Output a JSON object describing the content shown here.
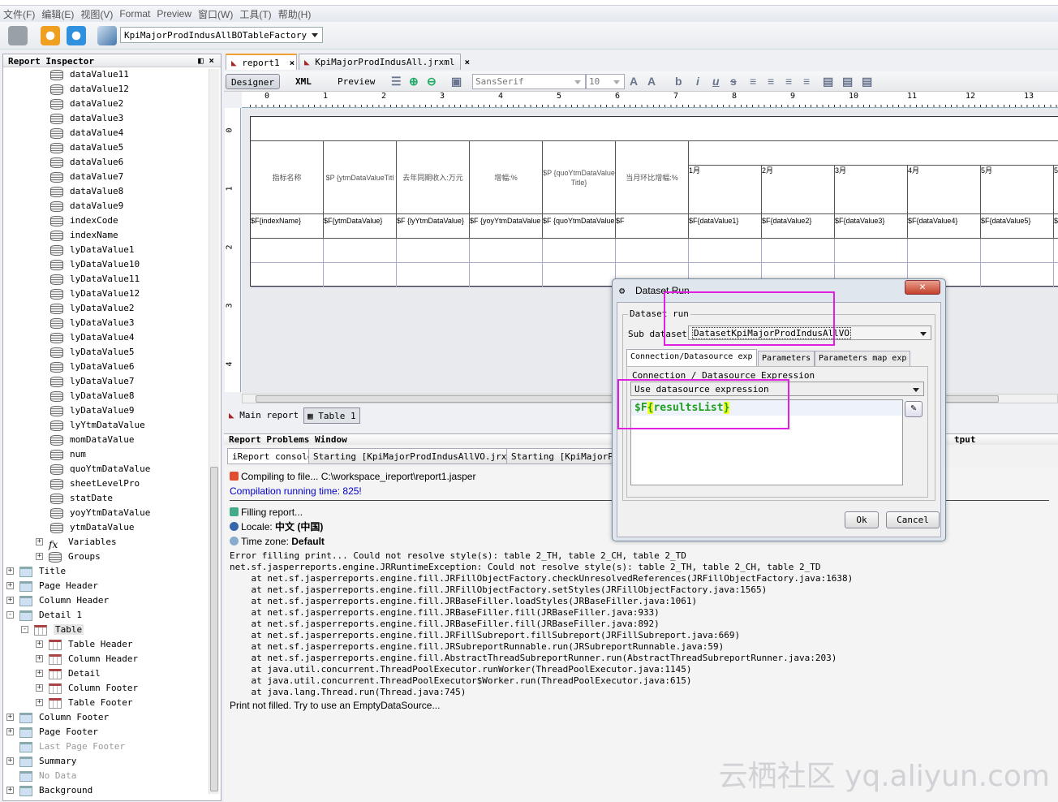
{
  "menu": [
    "文件(F)",
    "编辑(E)",
    "视图(V)",
    "Format",
    "Preview",
    "窗口(W)",
    "工具(T)",
    "帮助(H)"
  ],
  "toolbar": {
    "datasource": "KpiMajorProdIndusAllBOTableFactory"
  },
  "inspector": {
    "title": "Report Inspector",
    "fields": [
      "dataValue11",
      "dataValue12",
      "dataValue2",
      "dataValue3",
      "dataValue4",
      "dataValue5",
      "dataValue6",
      "dataValue7",
      "dataValue8",
      "dataValue9",
      "indexCode",
      "indexName",
      "lyDataValue1",
      "lyDataValue10",
      "lyDataValue11",
      "lyDataValue12",
      "lyDataValue2",
      "lyDataValue3",
      "lyDataValue4",
      "lyDataValue5",
      "lyDataValue6",
      "lyDataValue7",
      "lyDataValue8",
      "lyDataValue9",
      "lyYtmDataValue",
      "momDataValue",
      "num",
      "quoYtmDataValue",
      "sheetLevelPro",
      "statDate",
      "yoyYtmDataValue",
      "ytmDataValue"
    ],
    "nodes": [
      {
        "label": "Variables",
        "level": 2,
        "icon": "fx",
        "exp": "+"
      },
      {
        "label": "Groups",
        "level": 2,
        "icon": "groups",
        "exp": "+"
      },
      {
        "label": "Title",
        "level": 0,
        "icon": "band",
        "exp": "+"
      },
      {
        "label": "Page Header",
        "level": 0,
        "icon": "band",
        "exp": "+"
      },
      {
        "label": "Column Header",
        "level": 0,
        "icon": "band",
        "exp": "+"
      },
      {
        "label": "Detail 1",
        "level": 0,
        "icon": "band",
        "exp": "-"
      },
      {
        "label": "Table",
        "level": 1,
        "icon": "table",
        "exp": "-",
        "selected": true
      },
      {
        "label": "Table Header",
        "level": 2,
        "icon": "table",
        "exp": "+"
      },
      {
        "label": "Column Header",
        "level": 2,
        "icon": "table",
        "exp": "+"
      },
      {
        "label": "Detail",
        "level": 2,
        "icon": "table",
        "exp": "+"
      },
      {
        "label": "Column Footer",
        "level": 2,
        "icon": "table",
        "exp": "+"
      },
      {
        "label": "Table Footer",
        "level": 2,
        "icon": "table",
        "exp": "+"
      },
      {
        "label": "Column Footer",
        "level": 0,
        "icon": "band",
        "exp": "+"
      },
      {
        "label": "Page Footer",
        "level": 0,
        "icon": "band",
        "exp": "+"
      },
      {
        "label": "Last Page Footer",
        "level": 0,
        "icon": "band",
        "exp": "",
        "disabled": true
      },
      {
        "label": "Summary",
        "level": 0,
        "icon": "band",
        "exp": "+"
      },
      {
        "label": "No Data",
        "level": 0,
        "icon": "band",
        "exp": "",
        "disabled": true
      },
      {
        "label": "Background",
        "level": 0,
        "icon": "band",
        "exp": "+"
      }
    ]
  },
  "editor": {
    "tabs": [
      {
        "label": "report1",
        "active": true
      },
      {
        "label": "KpiMajorProdIndusAll.jrxml"
      }
    ],
    "views": [
      "Designer",
      "XML",
      "Preview"
    ],
    "font": "SansSerif",
    "size": "10",
    "ruler": [
      "0",
      "1",
      "2",
      "3",
      "4",
      "5",
      "6",
      "7",
      "8",
      "9",
      "10",
      "11",
      "12",
      "13"
    ],
    "vruler": [
      "0",
      "1",
      "2",
      "3",
      "4"
    ],
    "headers": [
      "指标名称",
      "$P {ytmDataValueTitl",
      "去年同期收入:万元",
      "增幅:%",
      "$P {quoYtmDataValue Title}",
      "当月环比增幅:%"
    ],
    "months": [
      "1月",
      "2月",
      "3月",
      "4月",
      "5月",
      "5"
    ],
    "details": [
      "$F{indexName}",
      "$F{ytmDataValue}",
      "$F {lyYtmDataValue}",
      "$F {yoyYtmDataValue",
      "$F {quoYtmDataValue",
      "$F",
      "$F{dataValue1}",
      "$F{dataValue2}",
      "$F{dataValue3}",
      "$F{dataValue4}",
      "$F{dataValue5}",
      "$"
    ],
    "bottom_tabs": [
      "Main report",
      "Table 1"
    ]
  },
  "problems": {
    "title": "Report Problems Window",
    "tabs": [
      "iReport console",
      "Starting [KpiMajorProdIndusAllVO.jrxml]",
      "Starting [KpiMajorPro"
    ],
    "right_label": "tput",
    "compiling": "Compiling to file... C:\\workspace_ireport\\report1.jasper",
    "compile_time": "Compilation running time: 825!",
    "filling": "Filling report...",
    "locale_label": "Locale: ",
    "locale_value": "中文 (中国)",
    "tz_label": "Time zone: ",
    "tz_value": "Default",
    "trace": [
      "Error filling print... Could not resolve style(s): table 2_TH, table 2_CH, table 2_TD",
      "net.sf.jasperreports.engine.JRRuntimeException: Could not resolve style(s): table 2_TH, table 2_CH, table 2_TD",
      "    at net.sf.jasperreports.engine.fill.JRFillObjectFactory.checkUnresolvedReferences(JRFillObjectFactory.java:1638)",
      "    at net.sf.jasperreports.engine.fill.JRFillObjectFactory.setStyles(JRFillObjectFactory.java:1565)",
      "    at net.sf.jasperreports.engine.fill.JRBaseFiller.loadStyles(JRBaseFiller.java:1061)",
      "    at net.sf.jasperreports.engine.fill.JRBaseFiller.fill(JRBaseFiller.java:933)",
      "    at net.sf.jasperreports.engine.fill.JRBaseFiller.fill(JRBaseFiller.java:892)",
      "    at net.sf.jasperreports.engine.fill.JRFillSubreport.fillSubreport(JRFillSubreport.java:669)",
      "    at net.sf.jasperreports.engine.fill.JRSubreportRunnable.run(JRSubreportRunnable.java:59)",
      "    at net.sf.jasperreports.engine.fill.AbstractThreadSubreportRunner.run(AbstractThreadSubreportRunner.java:203)",
      "    at java.util.concurrent.ThreadPoolExecutor.runWorker(ThreadPoolExecutor.java:1145)",
      "    at java.util.concurrent.ThreadPoolExecutor$Worker.run(ThreadPoolExecutor.java:615)",
      "    at java.lang.Thread.run(Thread.java:745)"
    ],
    "not_filled": "Print not filled. Try to use an EmptyDataSource..."
  },
  "dialog": {
    "title": "Dataset Run",
    "group": "Dataset run",
    "sub_label": "Sub dataset",
    "sub_value": "DatasetKpiMajorProdIndusAllVO",
    "tabs": [
      "Connection/Datasource exp",
      "Parameters",
      "Parameters map exp"
    ],
    "conn_label": "Connection / Datasource Expression",
    "conn_mode": "Use datasource expression",
    "expr_prefix": "$F",
    "expr_open": "{",
    "expr_name": "resultsList",
    "expr_close": "}",
    "ok": "Ok",
    "cancel": "Cancel"
  },
  "watermark": "云栖社区 yq.aliyun.com",
  "colors": {
    "highlight": "#e020e0",
    "expr_green": "#20a020",
    "brace_bg": "#f0ff20",
    "compile_blue": "#0000cc"
  }
}
